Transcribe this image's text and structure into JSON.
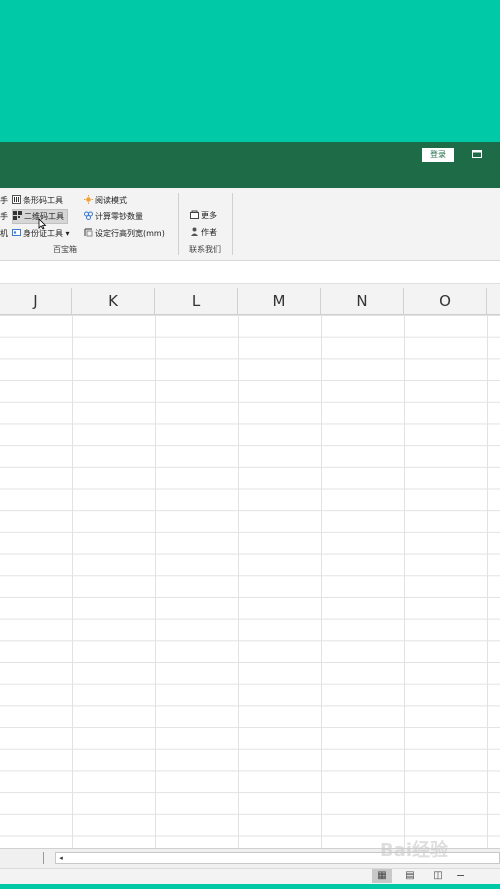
{
  "titlebar": {
    "login_label": "登录"
  },
  "ribbon": {
    "left_partials": [
      "手",
      "手",
      "机"
    ],
    "col1": [
      {
        "icon": "barcode-icon",
        "label": "条形码工具"
      },
      {
        "icon": "qrcode-icon",
        "label": "二维码工具"
      },
      {
        "icon": "idcard-icon",
        "label": "身份证工具 ▾"
      }
    ],
    "col2": [
      {
        "icon": "sun-icon",
        "label": "阅读模式"
      },
      {
        "icon": "calc-icon",
        "label": "计算零钞数量"
      },
      {
        "icon": "table-icon",
        "label": "设定行高列宽(mm)"
      }
    ],
    "group1_label": "百宝箱",
    "col3": [
      {
        "icon": "more-icon",
        "label": "更多"
      },
      {
        "icon": "person-icon",
        "label": "作者"
      }
    ],
    "group2_label": "联系我们"
  },
  "columns": [
    "J",
    "K",
    "L",
    "M",
    "N",
    "O"
  ],
  "statusbar": {
    "zoom_minus": "−"
  },
  "watermark": "Bai经验",
  "colors": {
    "teal": "#00c9a7",
    "title_green": "#1e6b47"
  }
}
